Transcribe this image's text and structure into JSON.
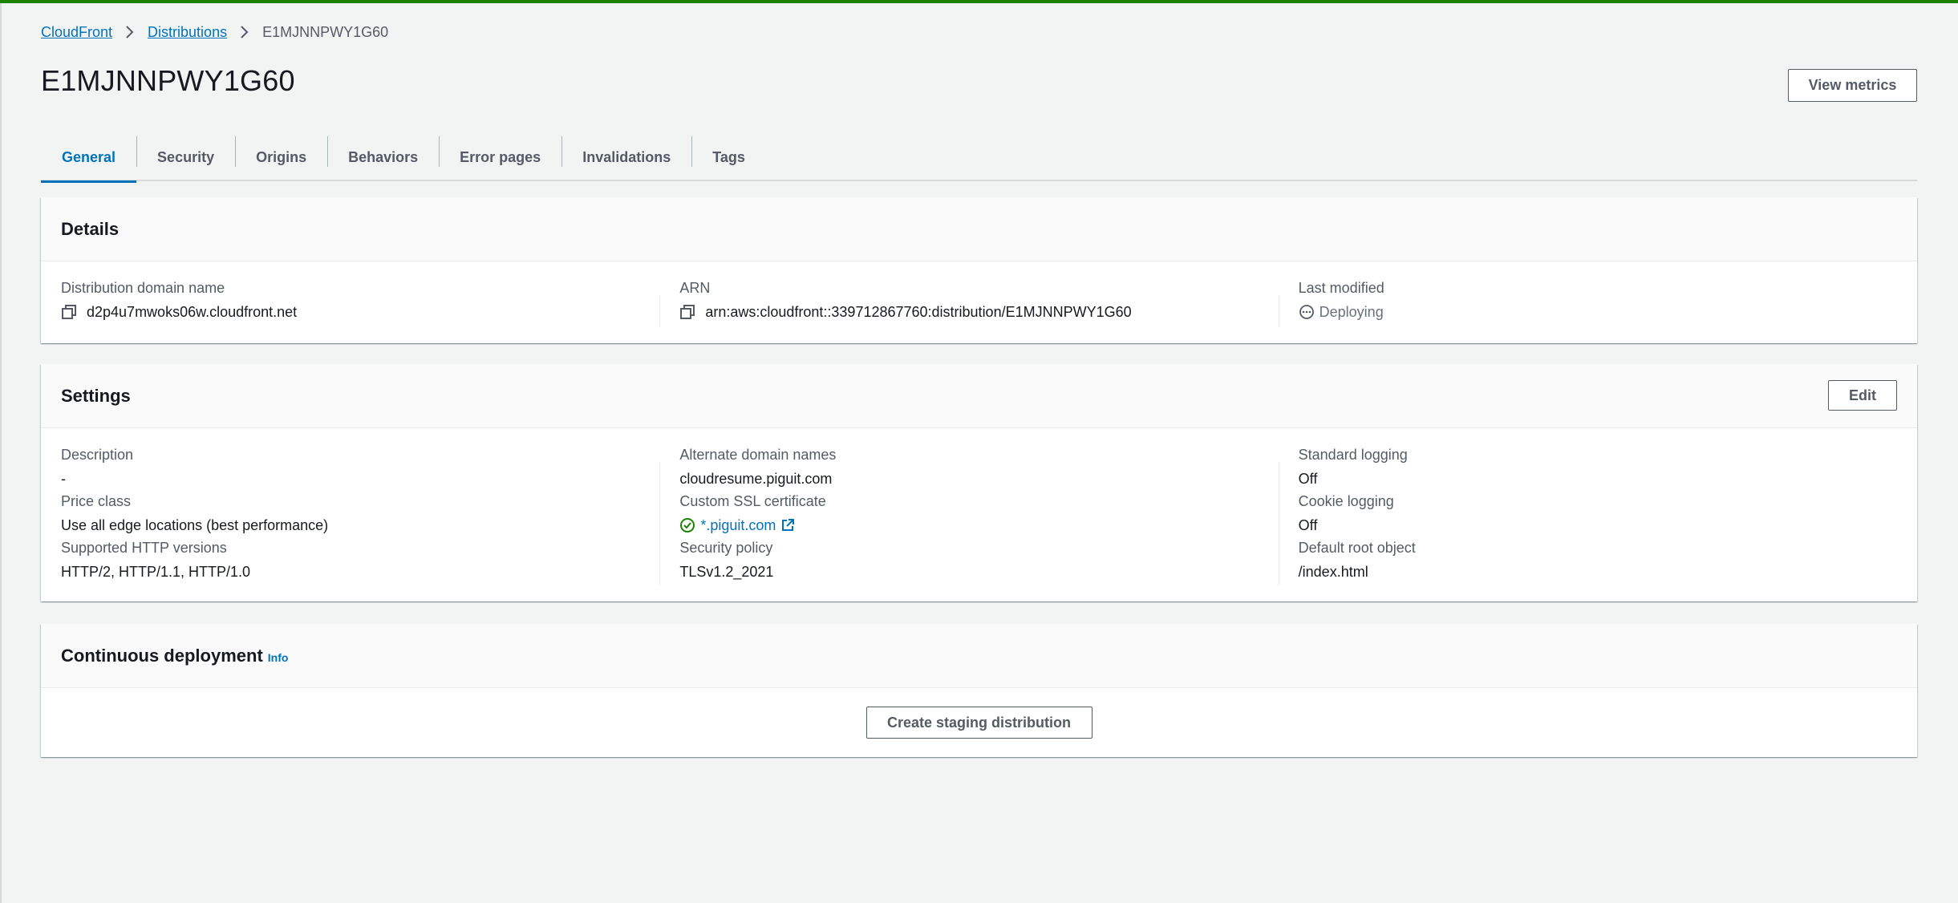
{
  "colors": {
    "success": "#1d8102",
    "link": "#0073bb",
    "text": "#16191f",
    "muted": "#545b64"
  },
  "breadcrumb": {
    "items": [
      "CloudFront",
      "Distributions"
    ],
    "current": "E1MJNNPWY1G60"
  },
  "page": {
    "title": "E1MJNNPWY1G60",
    "view_metrics_label": "View metrics"
  },
  "tabs": [
    "General",
    "Security",
    "Origins",
    "Behaviors",
    "Error pages",
    "Invalidations",
    "Tags"
  ],
  "details": {
    "title": "Details",
    "domain": {
      "label": "Distribution domain name",
      "value": "d2p4u7mwoks06w.cloudfront.net",
      "icon": "copy-icon"
    },
    "arn": {
      "label": "ARN",
      "value": "arn:aws:cloudfront::339712867760:distribution/E1MJNNPWY1G60",
      "icon": "copy-icon"
    },
    "last_modified": {
      "label": "Last modified",
      "value": "Deploying",
      "icon": "pending-status-icon"
    }
  },
  "settings": {
    "title": "Settings",
    "edit_label": "Edit",
    "description": {
      "label": "Description",
      "value": "-"
    },
    "price_class": {
      "label": "Price class",
      "value": "Use all edge locations (best performance)"
    },
    "http_versions": {
      "label": "Supported HTTP versions",
      "value": "HTTP/2, HTTP/1.1, HTTP/1.0"
    },
    "alternate_domains": {
      "label": "Alternate domain names",
      "value": "cloudresume.piguit.com"
    },
    "ssl_certificate": {
      "label": "Custom SSL certificate",
      "value": "*.piguit.com",
      "icon": "check-circle-icon"
    },
    "security_policy": {
      "label": "Security policy",
      "value": "TLSv1.2_2021"
    },
    "standard_logging": {
      "label": "Standard logging",
      "value": "Off"
    },
    "cookie_logging": {
      "label": "Cookie logging",
      "value": "Off"
    },
    "default_root": {
      "label": "Default root object",
      "value": "/index.html"
    }
  },
  "continuous_deployment": {
    "title": "Continuous deployment",
    "info_label": "Info",
    "create_label": "Create staging distribution"
  }
}
